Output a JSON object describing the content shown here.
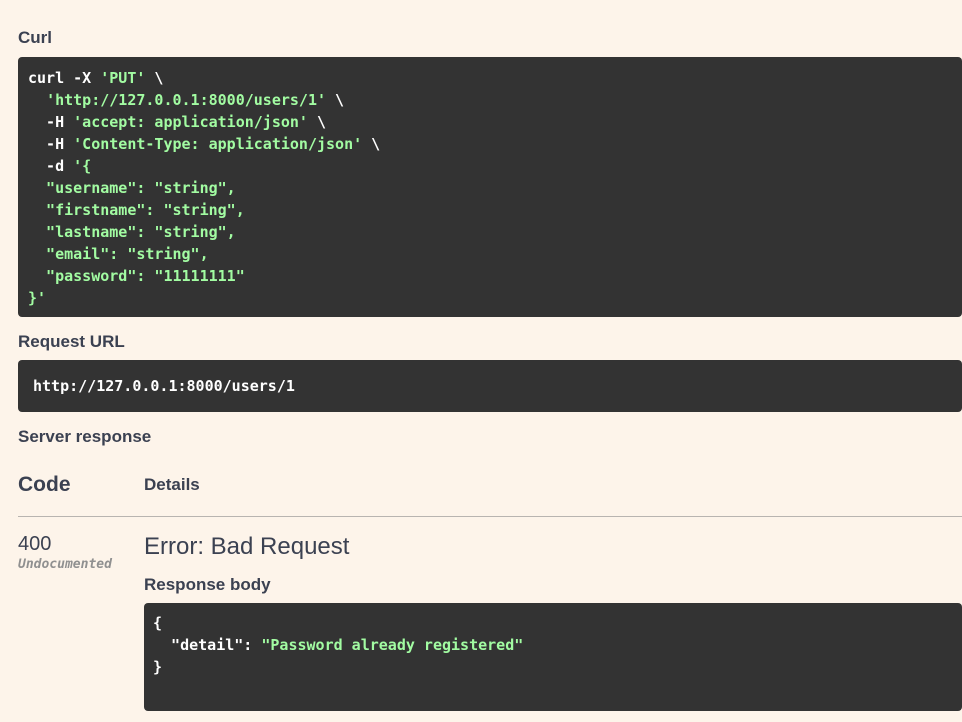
{
  "curl": {
    "label": "Curl",
    "lines": [
      [
        [
          "w",
          "curl -X "
        ],
        [
          "s",
          "'PUT'"
        ],
        [
          "w",
          " \\"
        ]
      ],
      [
        [
          "w",
          "  "
        ],
        [
          "s",
          "'http://127.0.0.1:8000/users/1'"
        ],
        [
          "w",
          " \\"
        ]
      ],
      [
        [
          "w",
          "  -H "
        ],
        [
          "s",
          "'accept: application/json'"
        ],
        [
          "w",
          " \\"
        ]
      ],
      [
        [
          "w",
          "  -H "
        ],
        [
          "s",
          "'Content-Type: application/json'"
        ],
        [
          "w",
          " \\"
        ]
      ],
      [
        [
          "w",
          "  -d "
        ],
        [
          "s",
          "'{"
        ]
      ],
      [
        [
          "s",
          "  \"username\": \"string\","
        ]
      ],
      [
        [
          "s",
          "  \"firstname\": \"string\","
        ]
      ],
      [
        [
          "s",
          "  \"lastname\": \"string\","
        ]
      ],
      [
        [
          "s",
          "  \"email\": \"string\","
        ]
      ],
      [
        [
          "s",
          "  \"password\": \"11111111\""
        ]
      ],
      [
        [
          "s",
          "}'"
        ]
      ]
    ]
  },
  "request_url": {
    "label": "Request URL",
    "value": "http://127.0.0.1:8000/users/1"
  },
  "server_response": {
    "label": "Server response",
    "col_code": "Code",
    "col_details": "Details",
    "code": "400",
    "code_note": "Undocumented",
    "error_title": "Error: Bad Request",
    "body_label": "Response body",
    "body_lines": [
      [
        [
          "w",
          "{"
        ]
      ],
      [
        [
          "w",
          "  \"detail\": "
        ],
        [
          "s",
          "\"Password already registered\""
        ]
      ],
      [
        [
          "w",
          "}"
        ]
      ]
    ]
  }
}
